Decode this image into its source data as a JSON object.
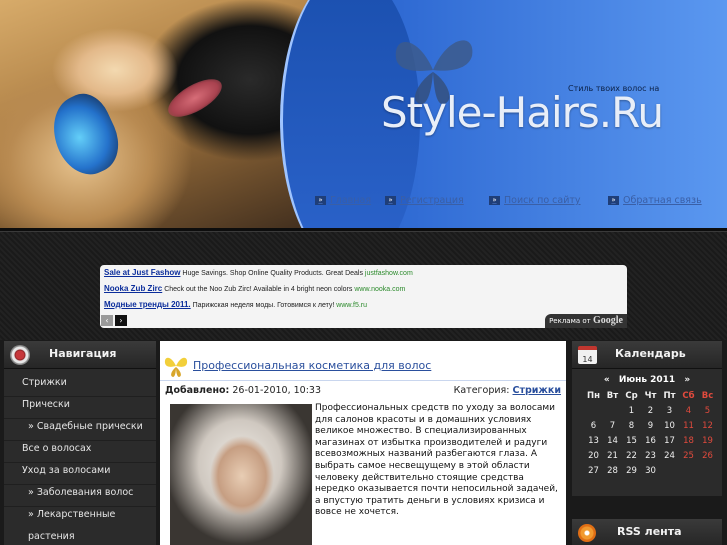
{
  "site": {
    "tagline": "Стиль твоих волос на",
    "logo": "Style-Hairs.Ru"
  },
  "top_nav": [
    {
      "label": "Главная"
    },
    {
      "label": "Регистрация"
    },
    {
      "label": "Поиск по сайту"
    },
    {
      "label": "Обратная связь"
    }
  ],
  "ads": {
    "items": [
      {
        "title": "Sale at Just Fashow",
        "text": "Huge Savings. Shop Online Quality Products. Great Deals",
        "url": "justfashow.com"
      },
      {
        "title": "Nooka Zub Zirc",
        "text": "Check out the Noo Zub Zirc! Available in 4 bright neon colors",
        "url": "www.nooka.com"
      },
      {
        "title": "Модные тренды 2011.",
        "text": "Парижская неделя моды. Готовимся к лету!",
        "url": "www.f5.ru"
      }
    ],
    "prev_icon": "‹",
    "next_icon": "›",
    "google_label": "Реклама от",
    "google_brand": "Google"
  },
  "nav_panel": {
    "title": "Навигация",
    "items": [
      {
        "label": "Стрижки"
      },
      {
        "label": "Прически"
      },
      {
        "label": "» Свадебные прически"
      },
      {
        "label": "Все о волосах"
      },
      {
        "label": "Уход за волосами"
      },
      {
        "label": "» Заболевания волос"
      },
      {
        "label": "» Лекарственные"
      },
      {
        "label": "растения"
      }
    ]
  },
  "article": {
    "title": "Профессиональная косметика для волос",
    "added_label": "Добавлено:",
    "added_date": "26-01-2010, 10:33",
    "category_label": "Категория:",
    "category": "Стрижки",
    "text": "Профессиональных средств по уходу за волосами для салонов красоты и в домашних условиях великое множество. В специализированных магазинах от избытка производителей и радуги всевозможных названий разбегаются глаза. А выбрать самое несвещущему в этой области человеку действительно стоящие средства нередко оказывается почти непосильной задачей, а впустую тратить деньги в условиях кризиса и вовсе не хочется."
  },
  "calendar": {
    "title": "Календарь",
    "icon_day": "14",
    "prev": "«",
    "month": "Июнь 2011",
    "next": "»",
    "weekdays": [
      "Пн",
      "Вт",
      "Ср",
      "Чт",
      "Пт",
      "Сб",
      "Вс"
    ],
    "weeks": [
      [
        "",
        "",
        "1",
        "2",
        "3",
        "4",
        "5"
      ],
      [
        "6",
        "7",
        "8",
        "9",
        "10",
        "11",
        "12"
      ],
      [
        "13",
        "14",
        "15",
        "16",
        "17",
        "18",
        "19"
      ],
      [
        "20",
        "21",
        "22",
        "23",
        "24",
        "25",
        "26"
      ],
      [
        "27",
        "28",
        "29",
        "30",
        "",
        "",
        ""
      ]
    ]
  },
  "rss": {
    "title": "RSS лента"
  },
  "colors": {
    "header_blue": "#2f6ad3",
    "link_blue": "#2a4f9d",
    "weekend_red": "#e04a3d"
  }
}
